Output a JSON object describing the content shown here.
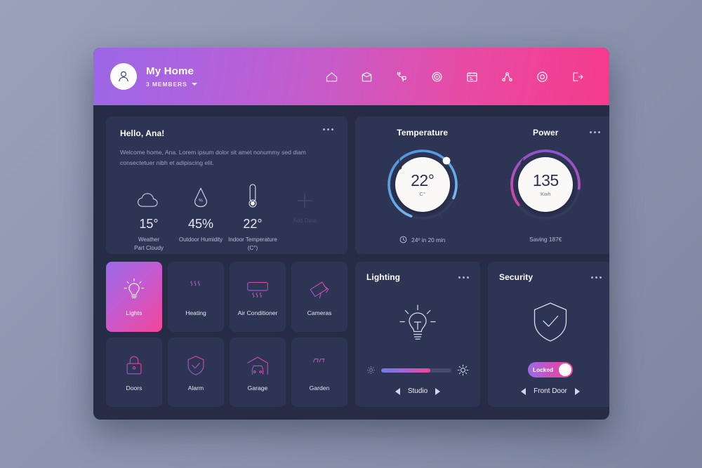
{
  "header": {
    "title": "My Home",
    "members": "3 MEMBERS",
    "avatar_icon": "user-avatar-icon",
    "dropdown_icon": "chevron-down-icon",
    "gradient_start": "#9b67e6",
    "gradient_end": "#f53a8c",
    "nav": [
      {
        "name": "home-icon",
        "label": "Home"
      },
      {
        "name": "rooms-icon",
        "label": "Rooms"
      },
      {
        "name": "plug-icon",
        "label": "Devices"
      },
      {
        "name": "target-icon",
        "label": "Automation"
      },
      {
        "name": "calendar-icon",
        "label": "Schedule"
      },
      {
        "name": "network-icon",
        "label": "Network"
      },
      {
        "name": "settings-circle-icon",
        "label": "Settings"
      },
      {
        "name": "logout-icon",
        "label": "Log out"
      }
    ]
  },
  "welcome": {
    "greeting": "Hello, Ana!",
    "message": "Welcome home, Ana. Lorem ipsum dolor sit amet nonummy sed diam consectetuer nibh et adipiscing elit.",
    "menu_icon": "more-options-icon",
    "stats": [
      {
        "icon": "cloud-icon",
        "value": "15°",
        "label": "Weather\nPart Cloudy",
        "dim": false
      },
      {
        "icon": "humidity-drop-icon",
        "value": "45%",
        "label": "Outdoor Humidity",
        "dim": false
      },
      {
        "icon": "thermometer-icon",
        "value": "22°",
        "label": "Indoor Temperature\n(C°)",
        "dim": false
      },
      {
        "icon": "plus-icon",
        "value": "",
        "label": "Add Data",
        "dim": true
      }
    ]
  },
  "gauges": {
    "temperature": {
      "title": "Temperature",
      "value": "22°",
      "unit": "C°",
      "icon": "thermometer-needle-icon",
      "footer": "24º in 20 min",
      "footer_icon": "clock-icon",
      "arc_percent": 76,
      "arc_color_start": "#5fa8e8",
      "arc_color_end": "#9ec8ef"
    },
    "power": {
      "title": "Power",
      "value": "135",
      "unit": "Kwh",
      "icon": "lightning-bolt-icon",
      "footer": "Saving 187€",
      "menu_icon": "more-options-icon",
      "arc_percent": 62,
      "arc_color_start": "#8a5fd8",
      "arc_color_end": "#f23d8e"
    }
  },
  "tiles": [
    {
      "icon": "lightbulb-icon",
      "label": "Lights",
      "active": true
    },
    {
      "icon": "radiator-icon",
      "label": "Heating",
      "active": false
    },
    {
      "icon": "air-conditioner-icon",
      "label": "Air Conditioner",
      "active": false
    },
    {
      "icon": "camera-icon",
      "label": "Cameras",
      "active": false
    },
    {
      "icon": "lock-icon",
      "label": "Doors",
      "active": false
    },
    {
      "icon": "shield-check-icon",
      "label": "Alarm",
      "active": false
    },
    {
      "icon": "garage-car-icon",
      "label": "Garage",
      "active": false
    },
    {
      "icon": "garden-bench-icon",
      "label": "Garden",
      "active": false
    }
  ],
  "lighting": {
    "title": "Lighting",
    "menu_icon": "more-options-icon",
    "bulb_icon": "lightbulb-glow-icon",
    "brightness_percent": 70,
    "dim_icon": "brightness-low-icon",
    "bright_icon": "brightness-high-icon",
    "room": "Studio",
    "prev_icon": "arrow-left-icon",
    "next_icon": "arrow-right-icon"
  },
  "security": {
    "title": "Security",
    "menu_icon": "more-options-icon",
    "shield_icon": "shield-check-icon",
    "toggle_label": "Locked",
    "toggle_on": true,
    "zone": "Front Door",
    "prev_icon": "arrow-left-icon",
    "next_icon": "arrow-right-icon"
  }
}
